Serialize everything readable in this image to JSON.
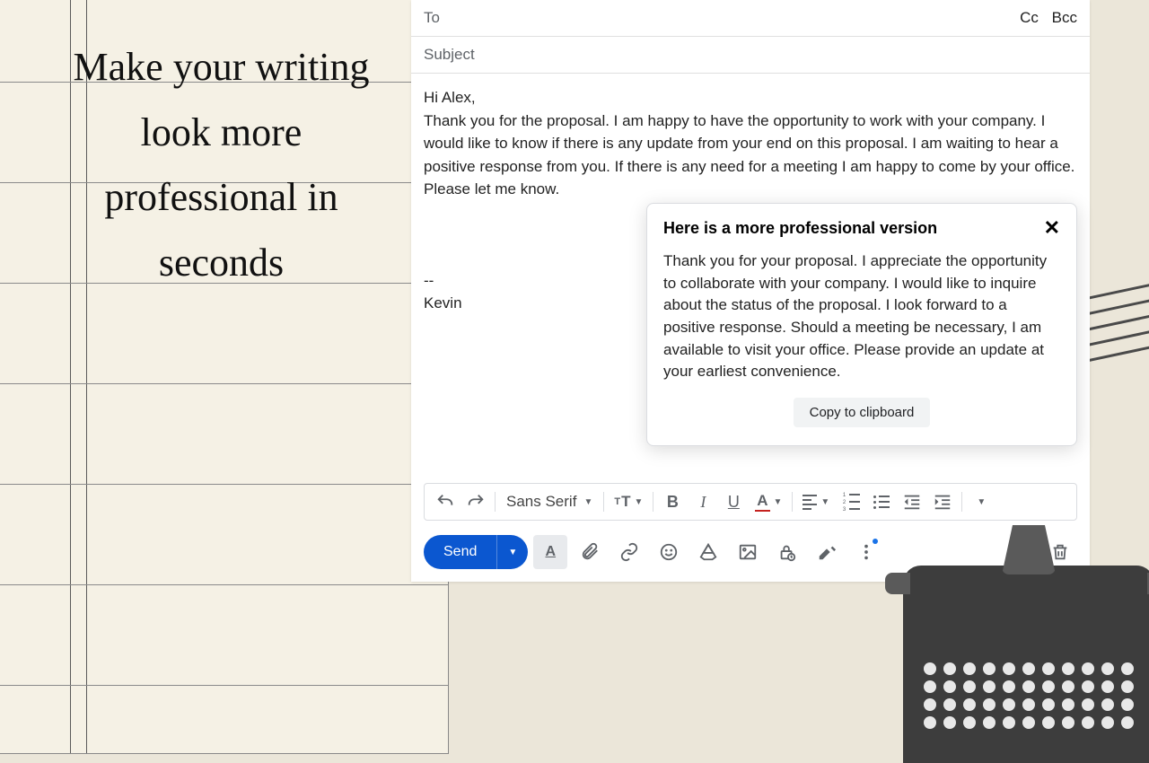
{
  "promo": "Make your writing look more professional in seconds",
  "compose": {
    "to_label": "To",
    "cc_label": "Cc",
    "bcc_label": "Bcc",
    "subject_placeholder": "Subject",
    "body": {
      "greeting": "Hi Alex,",
      "text": "Thank you for the proposal. I am happy to have the opportunity to work with your company. I would like to know if there is any update from your end on this proposal. I am waiting to hear a positive response from you. If there is any need for a meeting I am happy to come by your office. Please let me know.",
      "sig_divider": "--",
      "sig_name": "Kevin"
    }
  },
  "popup": {
    "title": "Here is a more professional version",
    "text": "Thank you for your proposal. I appreciate the opportunity to collaborate with your company. I would like to inquire about the status of the proposal. I look forward to a positive response. Should a meeting be necessary, I am available to visit your office. Please provide an update at your earliest convenience.",
    "copy_btn": "Copy to clipboard"
  },
  "toolbar": {
    "font": "Sans Serif",
    "send_label": "Send"
  }
}
